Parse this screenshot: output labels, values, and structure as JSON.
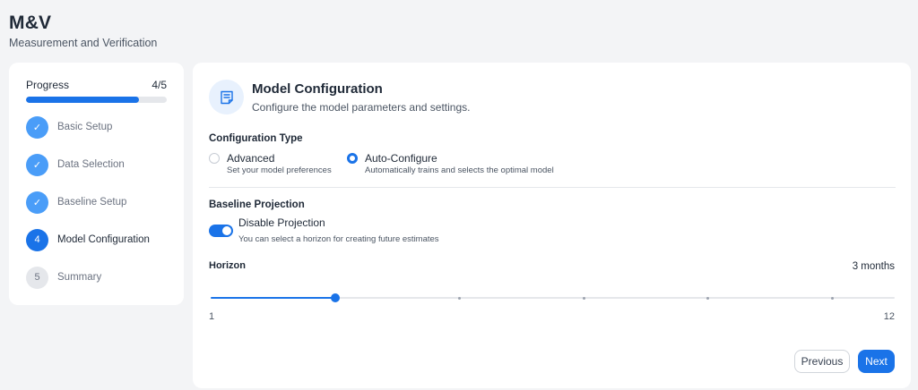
{
  "header": {
    "title": "M&V",
    "subtitle": "Measurement and Verification"
  },
  "sidebar": {
    "progress_label": "Progress",
    "progress_count": "4/5",
    "progress_fraction": 0.8,
    "steps": [
      {
        "marker": "✓",
        "label": "Basic Setup",
        "state": "done"
      },
      {
        "marker": "✓",
        "label": "Data Selection",
        "state": "done"
      },
      {
        "marker": "✓",
        "label": "Baseline Setup",
        "state": "done"
      },
      {
        "marker": "4",
        "label": "Model Configuration",
        "state": "current"
      },
      {
        "marker": "5",
        "label": "Summary",
        "state": "todo"
      }
    ]
  },
  "main": {
    "icon": "document-icon",
    "title": "Model Configuration",
    "description": "Configure the model parameters and settings.",
    "config_type": {
      "label": "Configuration Type",
      "options": [
        {
          "title": "Advanced",
          "subtitle": "Set your model preferences",
          "selected": false
        },
        {
          "title": "Auto-Configure",
          "subtitle": "Automatically trains and selects the optimal model",
          "selected": true
        }
      ]
    },
    "baseline": {
      "label": "Baseline Projection",
      "toggle_title": "Disable Projection",
      "toggle_subtitle": "You can select a horizon for creating future estimates",
      "toggle_on": true
    },
    "horizon": {
      "label": "Horizon",
      "value_text": "3 months",
      "min_label": "1",
      "max_label": "12",
      "min": 1,
      "max": 12,
      "value": 3
    },
    "buttons": {
      "previous": "Previous",
      "next": "Next"
    }
  },
  "colors": {
    "accent": "#1a73e8",
    "done_step": "#4a9df8",
    "background": "#f3f4f6"
  }
}
